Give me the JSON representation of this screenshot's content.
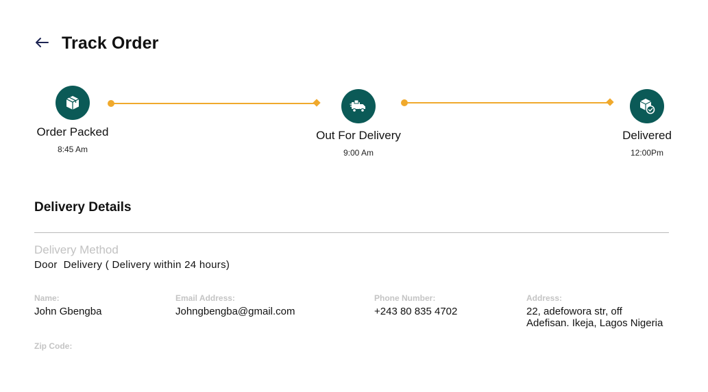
{
  "header": {
    "title": "Track Order",
    "back_icon": "arrow-left-icon"
  },
  "tracker": {
    "accent_color": "#f0a92c",
    "icon_bg_color": "#0b5a57",
    "steps": [
      {
        "label": "Order Packed",
        "time": "8:45 Am",
        "icon": "package-icon"
      },
      {
        "label": "Out For Delivery",
        "time": "9:00 Am",
        "icon": "delivery-truck-icon"
      },
      {
        "label": "Delivered",
        "time": "12:00Pm",
        "icon": "delivered-box-check-icon"
      }
    ]
  },
  "delivery": {
    "section_title": "Delivery Details",
    "method_label": "Delivery Method",
    "method_value": "Door  Delivery ( Delivery within 24 hours)",
    "fields": {
      "name": {
        "label": "Name:",
        "value": "John Gbengba"
      },
      "email": {
        "label": "Email Address:",
        "value": "Johngbengba@gmail.com"
      },
      "phone": {
        "label": "Phone Number:",
        "value": "+243 80 835 4702"
      },
      "address": {
        "label": "Address:",
        "line1": "22, adefowora str, off",
        "line2": "Adefisan. Ikeja, Lagos Nigeria"
      },
      "zip": {
        "label": "Zip Code:",
        "value": ""
      }
    }
  }
}
